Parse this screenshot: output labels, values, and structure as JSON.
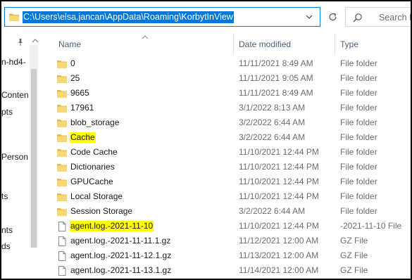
{
  "address_bar": {
    "path": "C:\\Users\\elsa.jancan\\AppData\\Roaming\\KorbytInView",
    "search_placeholder": "Search K"
  },
  "nav_pane": {
    "items": [
      "n-hd4-",
      "Conten",
      "pts",
      "Person",
      "ts",
      "nts",
      "ds"
    ]
  },
  "columns": {
    "name": "Name",
    "date_modified": "Date modified",
    "type": "Type"
  },
  "files": [
    {
      "name": "0",
      "date": "11/11/2021 8:49 AM",
      "type": "File folder",
      "kind": "folder",
      "highlight": false
    },
    {
      "name": "25",
      "date": "11/11/2021 9:05 AM",
      "type": "File folder",
      "kind": "folder",
      "highlight": false
    },
    {
      "name": "9665",
      "date": "11/11/2021 8:49 AM",
      "type": "File folder",
      "kind": "folder",
      "highlight": false
    },
    {
      "name": "17961",
      "date": "3/1/2022 8:13 AM",
      "type": "File folder",
      "kind": "folder",
      "highlight": false
    },
    {
      "name": "blob_storage",
      "date": "3/2/2022 6:44 AM",
      "type": "File folder",
      "kind": "folder",
      "highlight": false
    },
    {
      "name": "Cache",
      "date": "3/2/2022 6:44 AM",
      "type": "File folder",
      "kind": "folder",
      "highlight": true
    },
    {
      "name": "Code Cache",
      "date": "11/10/2021 12:44 PM",
      "type": "File folder",
      "kind": "folder",
      "highlight": false
    },
    {
      "name": "Dictionaries",
      "date": "11/10/2021 12:44 PM",
      "type": "File folder",
      "kind": "folder",
      "highlight": false
    },
    {
      "name": "GPUCache",
      "date": "11/10/2021 12:44 PM",
      "type": "File folder",
      "kind": "folder",
      "highlight": false
    },
    {
      "name": "Local Storage",
      "date": "11/10/2021 12:44 PM",
      "type": "File folder",
      "kind": "folder",
      "highlight": false
    },
    {
      "name": "Session Storage",
      "date": "3/2/2022 6:44 AM",
      "type": "File folder",
      "kind": "folder",
      "highlight": false
    },
    {
      "name": "agent.log.-2021-11-10",
      "date": "11/10/2021 12:44 PM",
      "type": "-2021-11-10 File",
      "kind": "file",
      "highlight": true
    },
    {
      "name": "agent.log.-2021-11-11.1.gz",
      "date": "11/12/2021 12:00 AM",
      "type": "GZ File",
      "kind": "file",
      "highlight": false
    },
    {
      "name": "agent.log.-2021-11-12.1.gz",
      "date": "11/13/2021 12:00 AM",
      "type": "GZ File",
      "kind": "file",
      "highlight": false
    },
    {
      "name": "agent.log.-2021-11-13.1.gz",
      "date": "11/14/2021 12:00 AM",
      "type": "GZ File",
      "kind": "file",
      "highlight": false
    }
  ],
  "colors": {
    "accent": "#0078d7",
    "highlight": "#ffff00",
    "folder": "#f8d775",
    "header_text": "#4c607a"
  }
}
